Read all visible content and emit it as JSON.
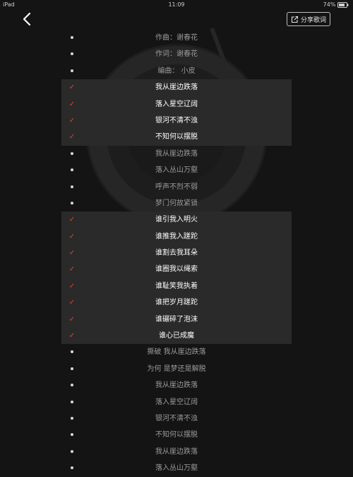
{
  "status": {
    "device": "iPad",
    "time": "11:09",
    "battery": "74%"
  },
  "header": {
    "share_label": "分享歌词"
  },
  "lyrics": [
    {
      "text": "作曲：谢春花",
      "selected": false
    },
    {
      "text": "作词：谢春花",
      "selected": false
    },
    {
      "text": "编曲： 小皮",
      "selected": false
    },
    {
      "text": "我从崖边跌落",
      "selected": true
    },
    {
      "text": "落入星空辽阔",
      "selected": true
    },
    {
      "text": "银河不清不浊",
      "selected": true
    },
    {
      "text": "不知何以摆脱",
      "selected": true
    },
    {
      "text": "我从崖边跌落",
      "selected": false
    },
    {
      "text": "落入丛山万壑",
      "selected": false
    },
    {
      "text": "呼声不烈不弱",
      "selected": false
    },
    {
      "text": "梦门何故紧锁",
      "selected": false
    },
    {
      "text": "谁引我入明火",
      "selected": true
    },
    {
      "text": "谁推我入蹉跎",
      "selected": true
    },
    {
      "text": "谁割去我耳朵",
      "selected": true
    },
    {
      "text": "谁圈我以绳索",
      "selected": true
    },
    {
      "text": "谁耻笑我执着",
      "selected": true
    },
    {
      "text": "谁把岁月蹉跎",
      "selected": true
    },
    {
      "text": "谁碾碎了泡沫",
      "selected": true
    },
    {
      "text": "谁心已成魔",
      "selected": true
    },
    {
      "text": "撕破 我从崖边跌落",
      "selected": false
    },
    {
      "text": "为何 是梦还是解脱",
      "selected": false
    },
    {
      "text": "我从崖边跌落",
      "selected": false
    },
    {
      "text": "落入星空辽阔",
      "selected": false
    },
    {
      "text": "银河不清不浊",
      "selected": false
    },
    {
      "text": "不知何以摆脱",
      "selected": false
    },
    {
      "text": "我从崖边跌落",
      "selected": false
    },
    {
      "text": "落入丛山万壑",
      "selected": false
    }
  ]
}
